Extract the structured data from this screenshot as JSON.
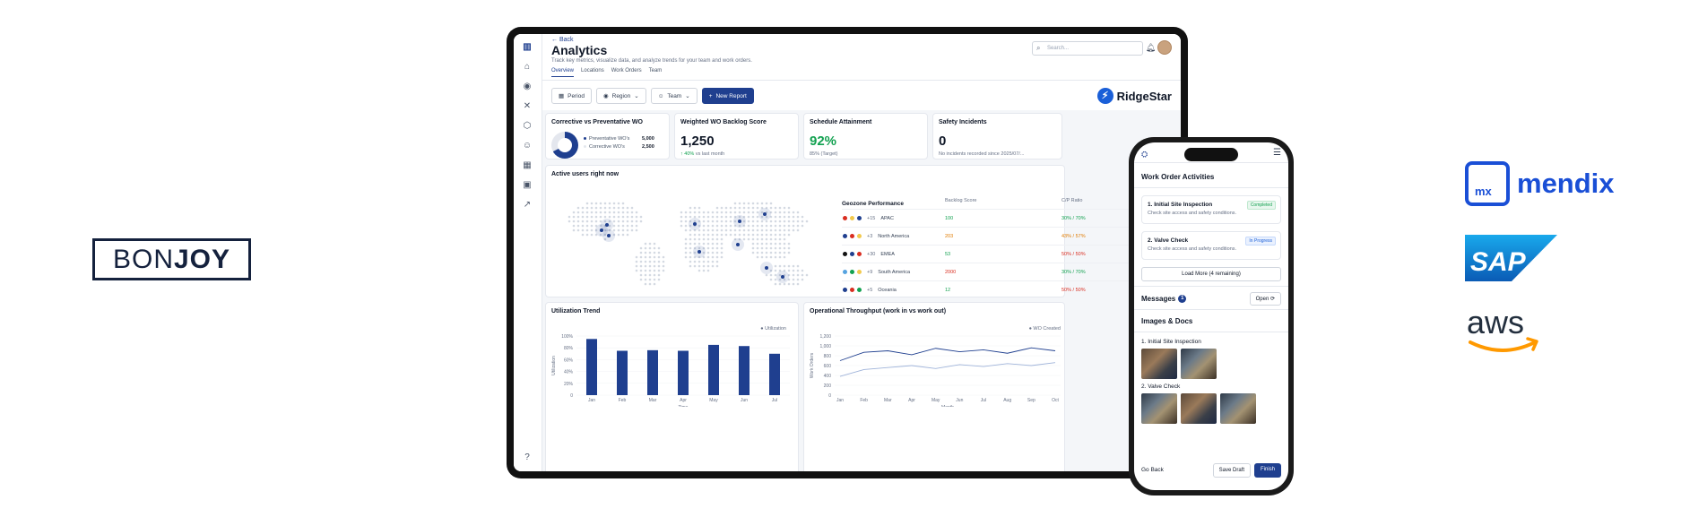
{
  "logos": {
    "bonjoy": {
      "part1": "BON",
      "part2": "JOY"
    },
    "mendix": {
      "mark": "mx",
      "word": "mendix"
    },
    "sap": {
      "word": "SAP"
    },
    "aws": {
      "word": "aws"
    }
  },
  "dashboard": {
    "back": "← Back",
    "title": "Analytics",
    "subtitle": "Track key metrics, visualize data, and analyze trends for your team and work orders.",
    "tabs": [
      "Overview",
      "Locations",
      "Work Orders",
      "Team"
    ],
    "active_tab": "Overview",
    "search_placeholder": "Search...",
    "filters": {
      "period": "Period",
      "region": "Region",
      "team": "Team",
      "new_report": "New Report"
    },
    "brand": "RidgeStar",
    "kpis": {
      "corrective": {
        "title": "Corrective vs Preventative WO",
        "preventative_label": "Preventative WO's",
        "preventative_value": "5,000",
        "corrective_label": "Corrective WO's",
        "corrective_value": "2,500"
      },
      "backlog": {
        "title": "Weighted WO Backlog Score",
        "value": "1,250",
        "change": "40%",
        "change_note": "vs last month"
      },
      "schedule": {
        "title": "Schedule Attainment",
        "value": "92%",
        "note": "85% (Target)"
      },
      "safety": {
        "title": "Safety Incidents",
        "value": "0",
        "note": "No incidents recorded since 2025/07/..."
      }
    },
    "active_users": {
      "title": "Active users right now",
      "geozone": {
        "headers": [
          "Geozone Performance",
          "Backlog Score",
          "C/P Ratio"
        ],
        "rows": [
          {
            "flags": [
              "#d92d20",
              "#f2c94c",
              "#1f3f8f"
            ],
            "extra": "+15",
            "region": "APAC",
            "score": "100",
            "score_color": "green",
            "ratio": "30% / 70%",
            "ratio_color": "green"
          },
          {
            "flags": [
              "#1f3f8f",
              "#d92d20",
              "#f2c94c"
            ],
            "extra": "+3",
            "region": "North America",
            "score": "203",
            "score_color": "orange",
            "ratio": "43% / 57%",
            "ratio_color": "orange"
          },
          {
            "flags": [
              "#111111",
              "#1f3f8f",
              "#d92d20"
            ],
            "extra": "+30",
            "region": "EMEA",
            "score": "53",
            "score_color": "green",
            "ratio": "50% / 50%",
            "ratio_color": "red"
          },
          {
            "flags": [
              "#56a3e0",
              "#12a150",
              "#f2c94c"
            ],
            "extra": "+9",
            "region": "South America",
            "score": "2000",
            "score_color": "red",
            "ratio": "30% / 70%",
            "ratio_color": "green"
          },
          {
            "flags": [
              "#1f3f8f",
              "#d92d20",
              "#12a150"
            ],
            "extra": "+5",
            "region": "Oceania",
            "score": "12",
            "score_color": "green",
            "ratio": "50% / 50%",
            "ratio_color": "red"
          }
        ]
      }
    },
    "utilization": {
      "title": "Utilization Trend",
      "legend": "Utilization"
    },
    "throughput": {
      "title": "Operational Throughput (work in vs work out)",
      "legend": "WO Created"
    }
  },
  "chart_data": [
    {
      "type": "bar",
      "title": "Utilization Trend",
      "categories": [
        "Jan",
        "Feb",
        "Mar",
        "Apr",
        "May",
        "Jun",
        "Jul"
      ],
      "series": [
        {
          "name": "Utilization",
          "values": [
            95,
            75,
            76,
            75,
            85,
            83,
            70
          ]
        }
      ],
      "xlabel": "Time",
      "ylabel": "Utilization",
      "yticks": [
        "0",
        "20%",
        "40%",
        "60%",
        "80%",
        "100%"
      ],
      "ylim": [
        0,
        100
      ],
      "color": "#1f3f8f"
    },
    {
      "type": "line",
      "title": "Operational Throughput (work in vs work out)",
      "categories": [
        "Jan",
        "Feb",
        "Mar",
        "Apr",
        "May",
        "Jun",
        "Jul",
        "Aug",
        "Sep",
        "Oct"
      ],
      "series": [
        {
          "name": "WO Created",
          "values": [
            700,
            870,
            900,
            820,
            950,
            880,
            920,
            850,
            960,
            900
          ]
        },
        {
          "name": "",
          "values": [
            380,
            520,
            560,
            600,
            540,
            620,
            580,
            640,
            600,
            660
          ]
        }
      ],
      "xlabel": "Month",
      "ylabel": "Work Orders",
      "yticks": [
        "0",
        "200",
        "400",
        "600",
        "800",
        "1,000",
        "1,200"
      ],
      "ylim": [
        0,
        1200
      ],
      "colors": [
        "#1f3f8f",
        "#9fb3d9"
      ]
    }
  ],
  "phone": {
    "title": "Work Order Activities",
    "activities": [
      {
        "name": "1. Initial Site Inspection",
        "desc": "Check site access and safety conditions.",
        "status": "Completed",
        "kind": "done"
      },
      {
        "name": "2. Valve Check",
        "desc": "Check site access and safety conditions.",
        "status": "In Progress",
        "kind": "prog"
      }
    ],
    "load_more": "Load More (4 remaining)",
    "messages_label": "Messages",
    "messages_count": "1",
    "open_label": "Open",
    "images_title": "Images & Docs",
    "img_group1": "1. Initial Site Inspection",
    "img_group2": "2. Valve Check",
    "go_back": "Go Back",
    "save_draft": "Save Draft",
    "finish": "Finish"
  }
}
